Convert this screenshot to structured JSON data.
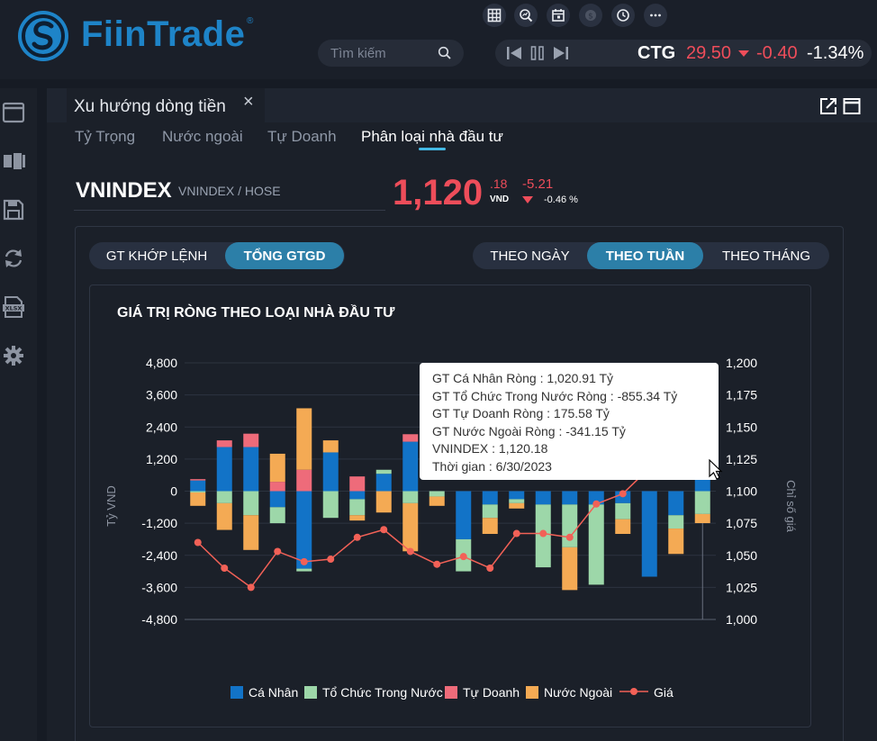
{
  "brand": {
    "name": "FiinTrade",
    "reg_mark": "®",
    "color": "#1e84c8"
  },
  "toolbar_icons": [
    "table-icon",
    "zoom-chart-icon",
    "calendar-icon",
    "coin-icon",
    "clock-icon",
    "more-icon"
  ],
  "search": {
    "placeholder": "Tìm kiếm"
  },
  "ticker": {
    "symbol": "CTG",
    "price": "29.50",
    "change": "-0.40",
    "percent": "-1.34%"
  },
  "sidebar_icons": [
    "window-icon",
    "film-icon",
    "save-icon",
    "refresh-icon",
    "xlsx-icon",
    "settings-icon"
  ],
  "panel": {
    "title": "Xu hướng dòng tiền",
    "close": "×"
  },
  "subtabs": [
    "Tỷ Trọng",
    "Nước ngoài",
    "Tự Doanh",
    "Phân loại nhà đầu tư"
  ],
  "index": {
    "name": "VNINDEX",
    "exchange": "VNINDEX / HOSE",
    "price": "1,120",
    "decimal": ".18",
    "unit": "VND",
    "change": "-5.21",
    "percent": "-0.46 %"
  },
  "value_toggle": {
    "options": [
      "GT KHỚP LỆNH",
      "TỔNG GTGD"
    ],
    "selected": "TỔNG GTGD"
  },
  "period_toggle": {
    "options": [
      "THEO NGÀY",
      "THEO TUẦN",
      "THEO THÁNG"
    ],
    "selected": "THEO TUẦN"
  },
  "tooltip": {
    "lines": [
      "GT Cá Nhân Ròng  : 1,020.91 Tỷ",
      "GT Tổ Chức Trong Nước Ròng : -855.34 Tỷ",
      "GT Tự Doanh Ròng : 175.58 Tỷ",
      "GT Nước Ngoài Ròng : -341.15 Tỷ",
      "VNINDEX : 1,120.18",
      "Thời gian : 6/30/2023"
    ]
  },
  "chart_data": {
    "type": "bar",
    "title": "GIÁ TRỊ RÒNG THEO LOẠI NHÀ ĐẦU TƯ",
    "ylabel": "Tỷ VND",
    "y2label": "Chỉ số giá",
    "ylim": [
      -4800,
      4800
    ],
    "y2lim": [
      1000,
      1200
    ],
    "yticks": [
      "4,800",
      "3,600",
      "2,400",
      "1,200",
      "0",
      "-1,200",
      "-2,400",
      "-3,600",
      "-4,800"
    ],
    "y2ticks": [
      "1,200",
      "1,175",
      "1,150",
      "1,125",
      "1,100",
      "1,075",
      "1,050",
      "1,025",
      "1,000"
    ],
    "stacked": true,
    "legend_position": "bottom",
    "series": [
      {
        "name": "Cá Nhân",
        "color": "#1273c7",
        "values": [
          400,
          1650,
          1650,
          -600,
          -2900,
          1450,
          -300,
          650,
          1850,
          0,
          -1800,
          -500,
          -300,
          -500,
          -500,
          -500,
          -450,
          -3200,
          -900,
          1020.91
        ]
      },
      {
        "name": "Tổ Chức Trong Nước",
        "color": "#9dd7a9",
        "values": [
          -50,
          -450,
          -900,
          -600,
          -100,
          -1000,
          -600,
          150,
          -450,
          -200,
          -1200,
          -500,
          -150,
          -2350,
          -1600,
          -3000,
          -600,
          0,
          -500,
          -855.34
        ]
      },
      {
        "name": "Tự Doanh",
        "color": "#ee6b7a",
        "values": [
          50,
          250,
          500,
          350,
          800,
          0,
          550,
          0,
          280,
          0,
          0,
          0,
          0,
          0,
          0,
          0,
          0,
          0,
          0,
          175.58
        ]
      },
      {
        "name": "Nước Ngoài",
        "color": "#f4aa54",
        "values": [
          -500,
          -1000,
          -1300,
          1050,
          2300,
          450,
          -200,
          -800,
          -1800,
          -350,
          0,
          -600,
          -200,
          0,
          -1600,
          0,
          -550,
          0,
          -950,
          -341.15
        ]
      }
    ],
    "line": {
      "name": "Giá",
      "color": "#f26157",
      "values": [
        1060,
        1040,
        1025,
        1053,
        1045,
        1047,
        1064,
        1070,
        1053,
        1043,
        1049,
        1040,
        1067,
        1067,
        1064,
        1090,
        1098,
        1118,
        1115,
        1120.18
      ]
    },
    "last_x_label": "6/30/2023"
  }
}
